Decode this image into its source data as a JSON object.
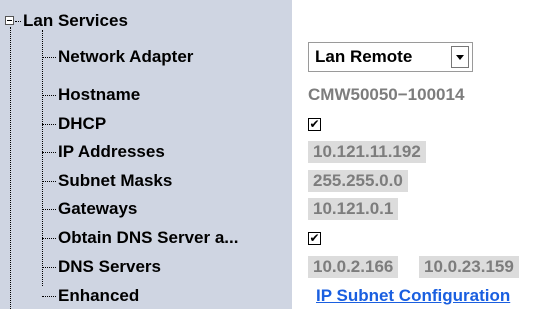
{
  "tree": {
    "root_label": "Lan Services",
    "items": [
      {
        "label": "Network Adapter"
      },
      {
        "label": "Hostname"
      },
      {
        "label": "DHCP"
      },
      {
        "label": "IP Addresses"
      },
      {
        "label": "Subnet Masks"
      },
      {
        "label": "Gateways"
      },
      {
        "label": "Obtain DNS Server a..."
      },
      {
        "label": "DNS Servers"
      },
      {
        "label": "Enhanced"
      }
    ]
  },
  "values": {
    "network_adapter": {
      "selected": "Lan Remote"
    },
    "hostname": "CMW50050−100014",
    "dhcp_checked": "✔",
    "ip_address": "10.121.11.192",
    "subnet_mask": "255.255.0.0",
    "gateway": "10.121.0.1",
    "obtain_dns_checked": "✔",
    "dns_servers": [
      "10.0.2.166",
      "10.0.23.159"
    ],
    "enhanced_link": "IP Subnet Configuration"
  },
  "colors": {
    "tree_background": "#cfd5e2",
    "link": "#1a5fe0",
    "readonly_value": "#7d7d7d",
    "readonly_box": "#dcdcdc"
  },
  "icons": {
    "expander": "collapse-minus-icon",
    "dropdown": "chevron-down-icon"
  }
}
